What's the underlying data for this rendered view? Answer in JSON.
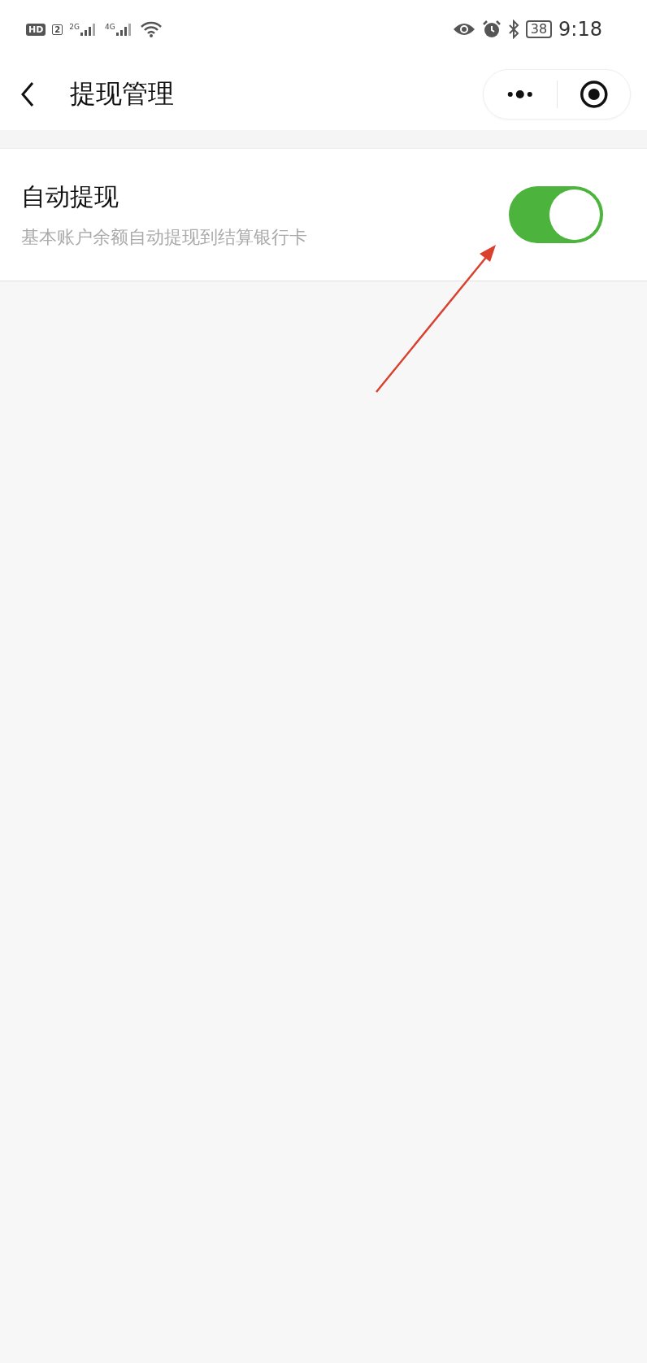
{
  "status_bar": {
    "hd": "HD",
    "sim": "2",
    "networks": [
      "2G",
      "4G"
    ],
    "battery": "38",
    "time": "9:18"
  },
  "nav": {
    "title": "提现管理"
  },
  "settings": [
    {
      "kind": "toggle",
      "title": "自动提现",
      "description": "基本账户余额自动提现到结算银行卡",
      "on": true
    }
  ],
  "annotation": {
    "kind": "arrow"
  }
}
